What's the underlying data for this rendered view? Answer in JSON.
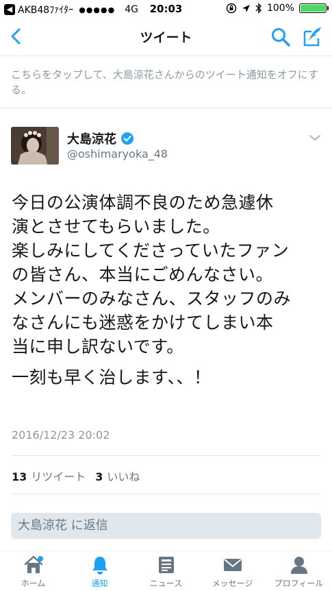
{
  "status_bar": {
    "carrier": "AKB48ﾌｧｲﾀｰ",
    "signal": "●●●●●",
    "network": "4G",
    "time": "20:03",
    "battery": "100%",
    "battery_level": 1.0
  },
  "nav": {
    "title": "ツイート"
  },
  "notice": "こちらをタップして、大島涼花さんからのツイート通知をオフにする。",
  "author": {
    "name": "大島涼花",
    "handle": "@oshimaryoka_48"
  },
  "tweet": {
    "lines": [
      "今日の公演体調不良のため急遽休",
      "演とさせてもらいました。",
      "楽しみにしてくださっていたファン",
      "の皆さん、本当にごめんなさい。",
      "メンバーのみなさん、スタッフのみ",
      "なさんにも迷惑をかけてしまい本",
      "当に申し訳ないです。"
    ],
    "closing": "一刻も早く治します、、！",
    "timestamp": "2016/12/23 20:02"
  },
  "stats": {
    "retweets_count": "13",
    "retweets_label": "リツイート",
    "likes_count": "3",
    "likes_label": "いいね"
  },
  "reply": {
    "placeholder": "大島涼花 に返信"
  },
  "tabs": [
    {
      "label": "ホーム",
      "icon": "home-icon"
    },
    {
      "label": "通知",
      "icon": "bell-icon"
    },
    {
      "label": "ニュース",
      "icon": "news-icon"
    },
    {
      "label": "メッセージ",
      "icon": "envelope-icon"
    },
    {
      "label": "プロフィール",
      "icon": "person-icon"
    }
  ],
  "colors": {
    "accent": "#1da1f2",
    "text": "#14171a",
    "muted": "#8899a6",
    "battery": "#4cd964"
  }
}
